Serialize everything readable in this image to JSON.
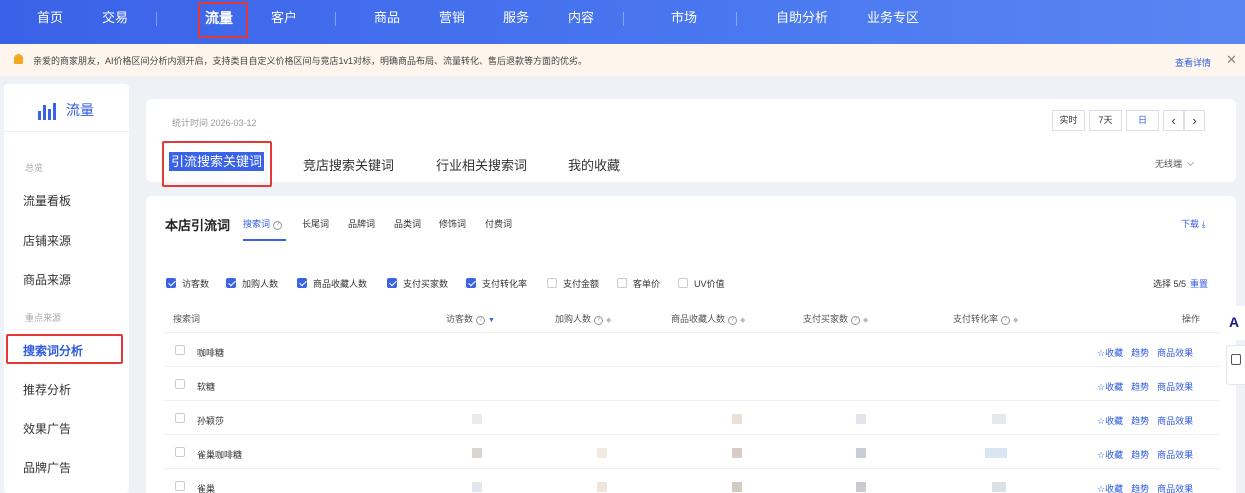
{
  "topnav": {
    "items": [
      "首页",
      "交易",
      "流量",
      "客户",
      "商品",
      "营销",
      "服务",
      "内容",
      "市场",
      "自助分析",
      "业务专区"
    ],
    "active": "流量"
  },
  "notice": {
    "text": "亲爱的商家朋友，AI价格区间分析内测开启，支持类目自定义价格区间与竞店1v1对标，明确商品布局、流量转化、售后退款等方面的优劣。",
    "link": "查看详情",
    "close": "✕"
  },
  "sidebar": {
    "brand": "流量",
    "group1": "总览",
    "items1": [
      "流量看板",
      "店铺来源",
      "商品来源"
    ],
    "group2": "重点来源",
    "items2": [
      "搜索词分析",
      "推荐分析",
      "效果广告",
      "品牌广告"
    ],
    "active": "搜索词分析"
  },
  "header": {
    "stat_time": "统计时间 2026-03-12",
    "ranges": [
      "实时",
      "7天",
      "日"
    ],
    "selected_range": "日",
    "prev": "‹",
    "next": "›"
  },
  "main_tabs": [
    "引流搜索关键词",
    "竞店搜索关键词",
    "行业相关搜索词",
    "我的收藏"
  ],
  "terminal": "无线端",
  "section": {
    "title": "本店引流词",
    "tabs": [
      "搜索词",
      "长尾词",
      "品牌词",
      "品类词",
      "修饰词",
      "付费词"
    ],
    "download": "下载 ⤓"
  },
  "metrics": [
    {
      "label": "访客数",
      "checked": true
    },
    {
      "label": "加购人数",
      "checked": true
    },
    {
      "label": "商品收藏人数",
      "checked": true
    },
    {
      "label": "支付买家数",
      "checked": true
    },
    {
      "label": "支付转化率",
      "checked": true
    },
    {
      "label": "支付金额",
      "checked": false
    },
    {
      "label": "客单价",
      "checked": false
    },
    {
      "label": "UV价值",
      "checked": false
    }
  ],
  "selection": {
    "text": "选择 5/5",
    "reset": "重置"
  },
  "table": {
    "headers": [
      "搜索词",
      "访客数",
      "加购人数",
      "商品收藏人数",
      "支付买家数",
      "支付转化率",
      "操作"
    ],
    "rows": [
      {
        "keyword": "咖啡糖"
      },
      {
        "keyword": "软糖"
      },
      {
        "keyword": "孙颖莎"
      },
      {
        "keyword": "雀巢咖啡糖"
      },
      {
        "keyword": "雀巢"
      }
    ],
    "actions": [
      "☆收藏",
      "趋势",
      "商品效果"
    ]
  },
  "colors": {
    "accent": "#3a62e8",
    "highlight_box": "#e53935",
    "notice_bg": "#fef6ec"
  }
}
